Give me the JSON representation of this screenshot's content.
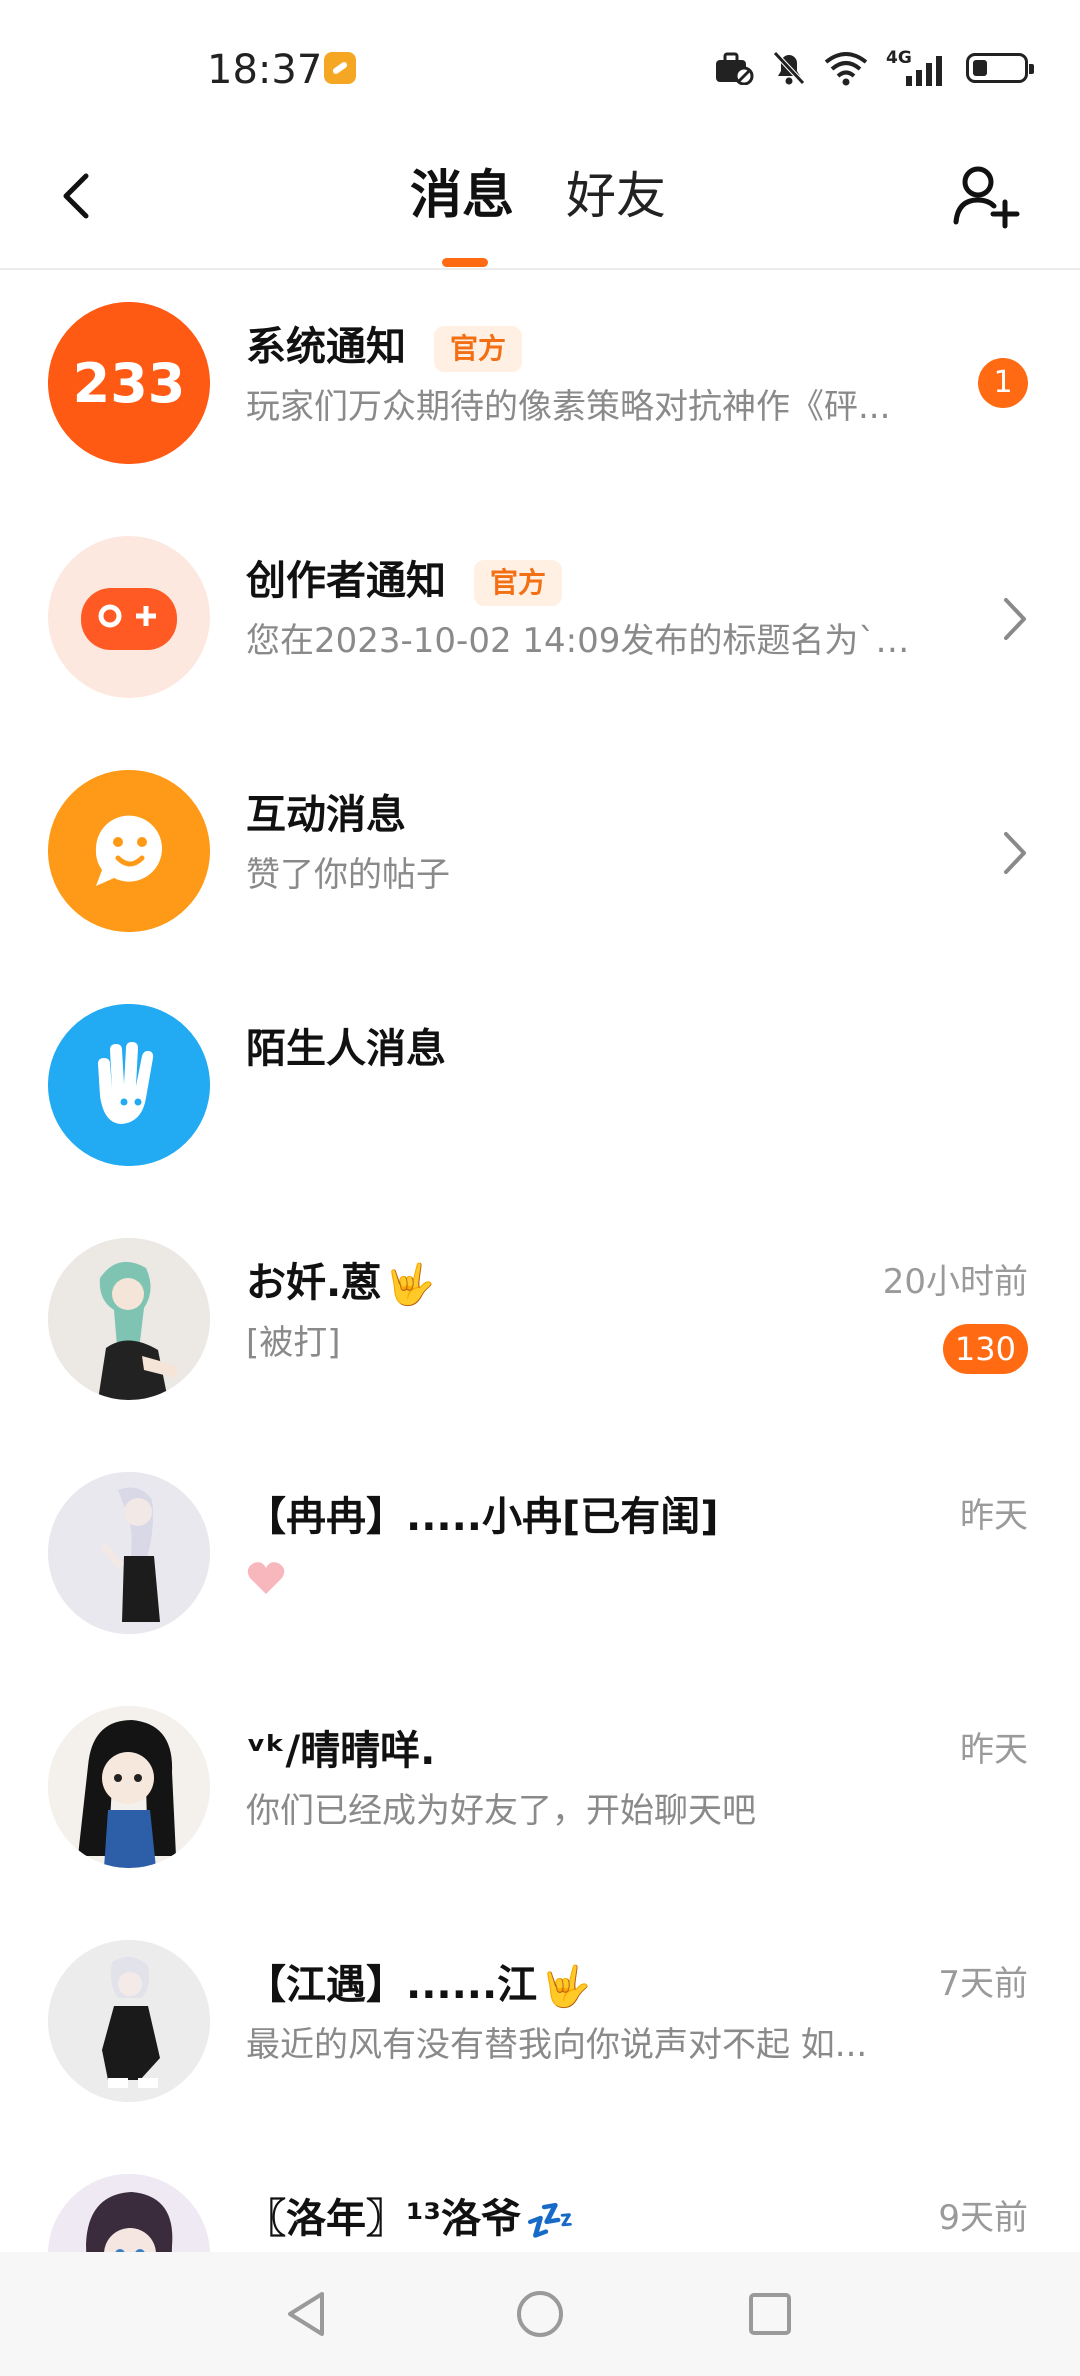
{
  "status_bar": {
    "time": "18:37",
    "icons": [
      "briefcase-icon",
      "bell-off-icon",
      "wifi-icon",
      "signal-4g-icon",
      "battery-icon"
    ],
    "network": "4G"
  },
  "header": {
    "tabs": [
      {
        "label": "消息",
        "active": true
      },
      {
        "label": "好友",
        "active": false
      }
    ],
    "accent": "#ff6a13"
  },
  "messages": [
    {
      "title": "系统通知",
      "tag": "官方",
      "preview": "玩家们万众期待的像素策略对抗神作《砰...",
      "badge": "1",
      "avatar_icon": "233-logo-icon",
      "avatar_color": "#ff5a14"
    },
    {
      "title": "创作者通知",
      "tag": "官方",
      "preview": "您在2023-10-02 14:09发布的标题名为`简...",
      "avatar_icon": "gamepad-icon",
      "avatar_color": "#fde8df"
    },
    {
      "title": "互动消息",
      "preview": "赞了你的帖子",
      "avatar_icon": "chat-bubble-smile-icon",
      "avatar_color": "#ff9a18"
    },
    {
      "title": "陌生人消息",
      "avatar_icon": "waving-hand-icon",
      "avatar_color": "#22aaf2"
    },
    {
      "title": "お奷.蒽",
      "emoji": "🤟",
      "preview": "[被打]",
      "time": "20小时前",
      "badge": "130"
    },
    {
      "title": "【冉冉】.....小冉[已有闺]",
      "preview_icon": "heart-icon",
      "time": "昨天"
    },
    {
      "title": "ᵛᵏ/晴晴咩.",
      "preview": "你们已经成为好友了，开始聊天吧",
      "time": "昨天"
    },
    {
      "title": "【江遇】......江",
      "emoji": "🤟",
      "preview": "最近的风有没有替我向你说声对不起 如...",
      "time": "7天前"
    },
    {
      "title": "〖洛年〗¹³洛爷",
      "emoji": "💤",
      "time": "9天前"
    }
  ],
  "nav": {
    "buttons": [
      "back-triangle-icon",
      "home-circle-icon",
      "recent-square-icon"
    ]
  }
}
